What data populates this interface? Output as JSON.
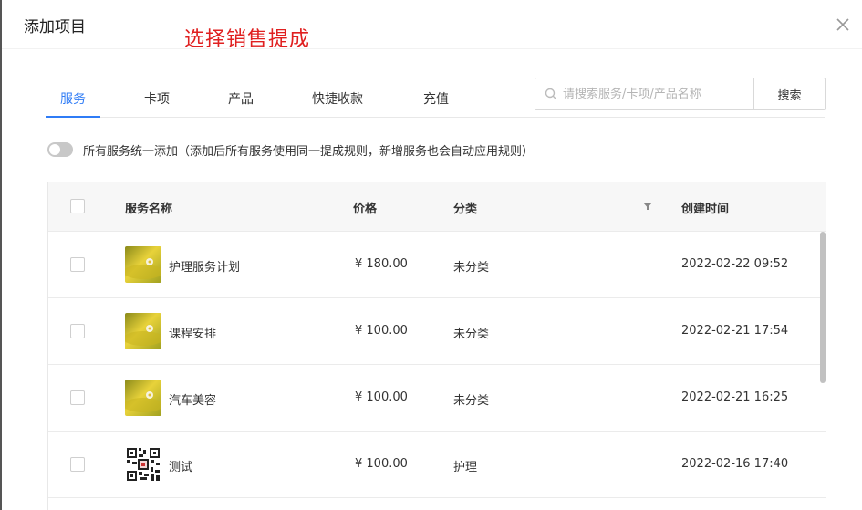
{
  "modal": {
    "title": "添加项目",
    "annotation": "选择销售提成"
  },
  "tabs": [
    {
      "label": "服务",
      "active": true
    },
    {
      "label": "卡项",
      "active": false
    },
    {
      "label": "产品",
      "active": false
    },
    {
      "label": "快捷收款",
      "active": false
    },
    {
      "label": "充值",
      "active": false
    }
  ],
  "search": {
    "value": "",
    "placeholder": "请搜索服务/卡项/产品名称",
    "button_label": "搜索"
  },
  "toggle": {
    "on": false,
    "label": "所有服务统一添加（添加后所有服务使用同一提成规则，新增服务也会自动应用规则）"
  },
  "table": {
    "columns": [
      "服务名称",
      "价格",
      "分类",
      "创建时间"
    ],
    "rows": [
      {
        "name": "护理服务计划",
        "price": "¥ 180.00",
        "category": "未分类",
        "created": "2022-02-22 09:52",
        "thumb": "flower-image"
      },
      {
        "name": "课程安排",
        "price": "¥ 100.00",
        "category": "未分类",
        "created": "2022-02-21 17:54",
        "thumb": "flower-image"
      },
      {
        "name": "汽车美容",
        "price": "¥ 100.00",
        "category": "未分类",
        "created": "2022-02-21 16:25",
        "thumb": "flower-image"
      },
      {
        "name": "测试",
        "price": "¥ 100.00",
        "category": "护理",
        "created": "2022-02-16 17:40",
        "thumb": "qr-code-image"
      }
    ]
  },
  "colors": {
    "accent": "#2f7cf6",
    "annotation": "#e02020",
    "header_bg": "#f7f7f7",
    "border": "#e8e8e8"
  },
  "icons": {
    "close": "close-icon",
    "search": "search-icon",
    "filter": "filter-icon"
  }
}
